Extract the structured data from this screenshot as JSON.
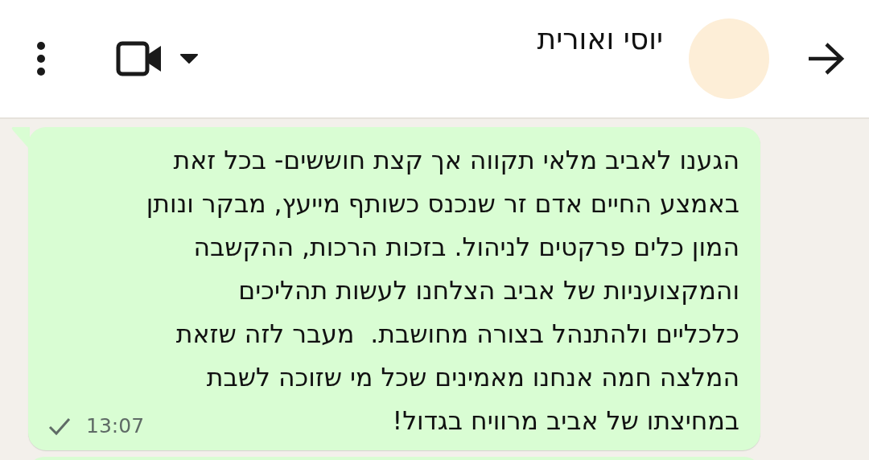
{
  "header": {
    "title": "יוסי ואורית"
  },
  "messages": [
    {
      "kind": "text",
      "text": "הגענו לאביב מלאי תקווה אך קצת חוששים- בכל זאת\nבאמצע החיים אדם זר שנכנס כשותף מייעץ, מבקר ונותן\nהמון כלים פרקטים לניהול. בזכות הרכות, ההקשבה\nוהמקצועניות של אביב הצלחנו לעשות תהליכים\nכלכליים ולהתנהל בצורה מחושבת.  מעבר לזה שזאת\nהמלצה חמה אנחנו מאמינים שכל מי שזוכה לשבת\nבמחיצתו של אביב מרוויח בגדול!",
      "time": "13:07",
      "sent": true
    },
    {
      "kind": "partial"
    }
  ]
}
